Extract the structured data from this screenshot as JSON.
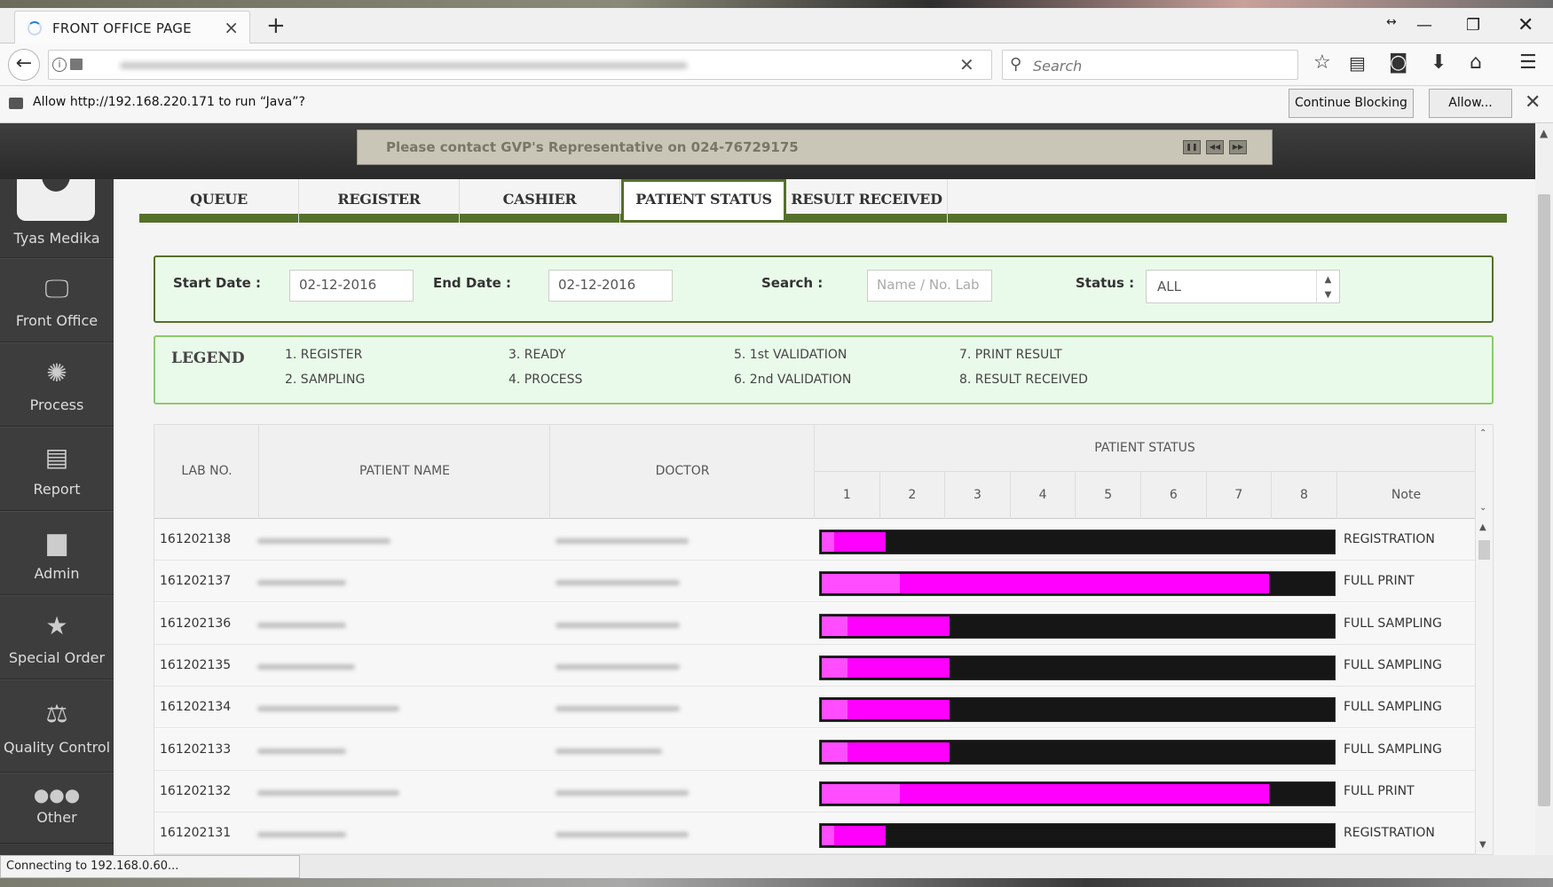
{
  "browser": {
    "tab_title": "FRONT OFFICE PAGE",
    "search_placeholder": "Search",
    "notification_text": "Allow http://192.168.220.171 to run “Java”?",
    "continue_blocking": "Continue Blocking",
    "allow": "Allow...",
    "status": "Connecting to 192.168.0.60..."
  },
  "marquee": "Please contact GVP's Representative on 024-76729175",
  "user": "Tyas Medika",
  "sidebar": [
    {
      "label": "Front Office",
      "icon": "monitor-icon"
    },
    {
      "label": "Process",
      "icon": "spinner-icon"
    },
    {
      "label": "Report",
      "icon": "document-icon"
    },
    {
      "label": "Admin",
      "icon": "admin-folder-icon"
    },
    {
      "label": "Special Order",
      "icon": "star-icon"
    },
    {
      "label": "Quality Control",
      "icon": "scales-icon"
    },
    {
      "label": "Other",
      "icon": "more-dots-icon"
    }
  ],
  "tabs": [
    "QUEUE",
    "REGISTER",
    "CASHIER",
    "PATIENT STATUS",
    "RESULT RECEIVED"
  ],
  "active_tab": "PATIENT STATUS",
  "filter": {
    "start_label": "Start Date :",
    "start_value": "02-12-2016",
    "end_label": "End Date :",
    "end_value": "02-12-2016",
    "search_label": "Search :",
    "search_placeholder": "Name / No. Lab",
    "status_label": "Status :",
    "status_value": "ALL"
  },
  "legend": {
    "title": "LEGEND",
    "items": [
      "1. REGISTER",
      "2. SAMPLING",
      "3. READY",
      "4. PROCESS",
      "5. 1st VALIDATION",
      "6. 2nd VALIDATION",
      "7. PRINT RESULT",
      "8. RESULT RECEIVED"
    ]
  },
  "table": {
    "headers": {
      "lab_no": "LAB NO.",
      "patient_name": "PATIENT NAME",
      "doctor": "DOCTOR",
      "patient_status": "PATIENT STATUS",
      "note": "Note"
    },
    "status_columns": [
      "1",
      "2",
      "3",
      "4",
      "5",
      "6",
      "7",
      "8"
    ],
    "rows": [
      {
        "lab_no": "161202138",
        "progress": 0.125,
        "note": "REGISTRATION"
      },
      {
        "lab_no": "161202137",
        "progress": 0.875,
        "note": "FULL PRINT"
      },
      {
        "lab_no": "161202136",
        "progress": 0.25,
        "note": "FULL SAMPLING"
      },
      {
        "lab_no": "161202135",
        "progress": 0.25,
        "note": "FULL SAMPLING"
      },
      {
        "lab_no": "161202134",
        "progress": 0.25,
        "note": "FULL SAMPLING"
      },
      {
        "lab_no": "161202133",
        "progress": 0.25,
        "note": "FULL SAMPLING"
      },
      {
        "lab_no": "161202132",
        "progress": 0.875,
        "note": "FULL PRINT"
      },
      {
        "lab_no": "161202131",
        "progress": 0.125,
        "note": "REGISTRATION"
      }
    ]
  },
  "colors": {
    "accent": "#55702b",
    "progress": "#ff00ff",
    "bar_bg": "#161616"
  }
}
